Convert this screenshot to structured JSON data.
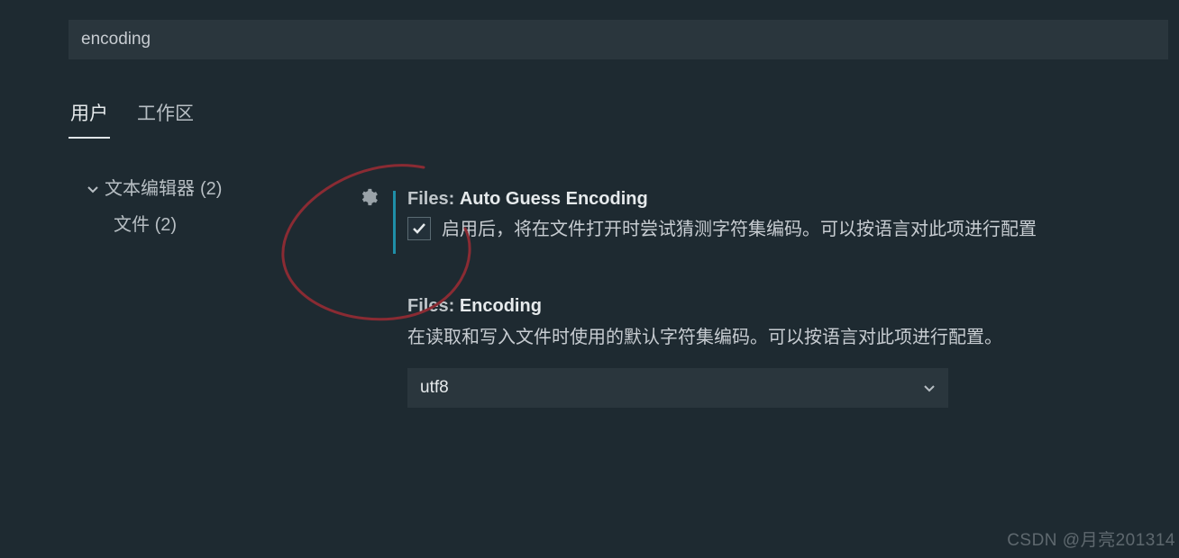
{
  "search": {
    "value": "encoding"
  },
  "tabs": {
    "user": "用户",
    "workspace": "工作区"
  },
  "tree": {
    "parent_label": "文本编辑器",
    "parent_count": "(2)",
    "child_label": "文件",
    "child_count": "(2)"
  },
  "setting1": {
    "prefix": "Files:",
    "name": "Auto Guess Encoding",
    "checked": true,
    "description": "启用后，将在文件打开时尝试猜测字符集编码。可以按语言对此项进行配置"
  },
  "setting2": {
    "prefix": "Files:",
    "name": "Encoding",
    "description": "在读取和写入文件时使用的默认字符集编码。可以按语言对此项进行配置。",
    "selected": "utf8"
  },
  "watermark": "CSDN @月亮201314"
}
